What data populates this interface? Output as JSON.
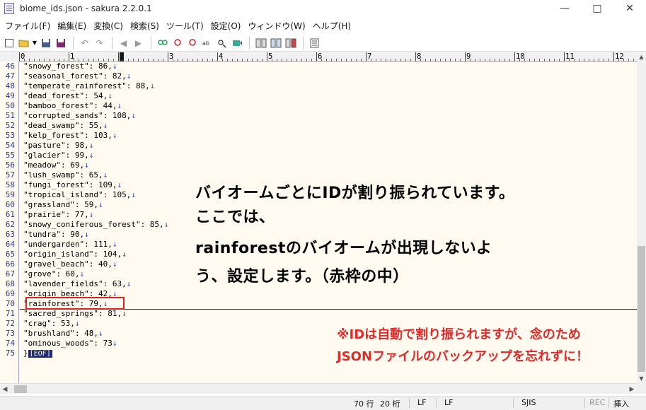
{
  "window": {
    "title": "biome_ids.json - sakura 2.2.0.1",
    "buttons": {
      "minimize": "—",
      "maximize": "□",
      "close": "✕"
    }
  },
  "menu": [
    "ファイル(F)",
    "編集(E)",
    "変換(C)",
    "検索(S)",
    "ツール(T)",
    "設定(O)",
    "ウィンドウ(W)",
    "ヘルプ(H)"
  ],
  "toolbar_icons": [
    "new-file-icon",
    "open-file-icon",
    "dropdown-icon",
    "save-icon",
    "save-all-icon",
    "undo-icon",
    "redo-icon",
    "jump-back-icon",
    "jump-forward-icon",
    "search-icon",
    "search-next-icon",
    "search-prev-icon",
    "replace-icon",
    "grep-icon",
    "tag-jump-icon",
    "compare-icon",
    "outline-icon",
    "function-list-icon",
    "settings-icon"
  ],
  "ruler": {
    "labels": [
      "0",
      "1",
      "2",
      "3",
      "4",
      "5",
      "6",
      "7",
      "8",
      "9",
      "10",
      "11",
      "12"
    ]
  },
  "editor": {
    "lines": [
      {
        "num": "46",
        "text": "\"snowy_forest\": 86,",
        "arrow": "↓"
      },
      {
        "num": "47",
        "text": "\"seasonal_forest\": 82,",
        "arrow": "↓"
      },
      {
        "num": "48",
        "text": "\"temperate_rainforest\": 88,",
        "arrow": "↓"
      },
      {
        "num": "49",
        "text": "\"dead_forest\": 54,",
        "arrow": "↓"
      },
      {
        "num": "50",
        "text": "\"bamboo_forest\": 44,",
        "arrow": "↓"
      },
      {
        "num": "51",
        "text": "\"corrupted_sands\": 108,",
        "arrow": "↓"
      },
      {
        "num": "52",
        "text": "\"dead_swamp\": 55,",
        "arrow": "↓"
      },
      {
        "num": "53",
        "text": "\"kelp_forest\": 103,",
        "arrow": "↓"
      },
      {
        "num": "54",
        "text": "\"pasture\": 98,",
        "arrow": "↓"
      },
      {
        "num": "55",
        "text": "\"glacier\": 99,",
        "arrow": "↓"
      },
      {
        "num": "56",
        "text": "\"meadow\": 69,",
        "arrow": "↓"
      },
      {
        "num": "57",
        "text": "\"lush_swamp\": 65,",
        "arrow": "↓"
      },
      {
        "num": "58",
        "text": "\"fungi_forest\": 109,",
        "arrow": "↓"
      },
      {
        "num": "59",
        "text": "\"tropical_island\": 105,",
        "arrow": "↓"
      },
      {
        "num": "60",
        "text": "\"grassland\": 59,",
        "arrow": "↓"
      },
      {
        "num": "61",
        "text": "\"prairie\": 77,",
        "arrow": "↓"
      },
      {
        "num": "62",
        "text": "\"snowy_coniferous_forest\": 85,",
        "arrow": "↓"
      },
      {
        "num": "63",
        "text": "\"tundra\": 90,",
        "arrow": "↓"
      },
      {
        "num": "64",
        "text": "\"undergarden\": 111,",
        "arrow": "↓"
      },
      {
        "num": "65",
        "text": "\"origin_island\": 104,",
        "arrow": "↓"
      },
      {
        "num": "66",
        "text": "\"gravel_beach\": 40,",
        "arrow": "↓"
      },
      {
        "num": "67",
        "text": "\"grove\": 60,",
        "arrow": "↓"
      },
      {
        "num": "68",
        "text": "\"lavender_fields\": 63,",
        "arrow": "↓"
      },
      {
        "num": "69",
        "text": "\"origin_beach\": 42,",
        "arrow": "↓"
      },
      {
        "num": "70",
        "text": "\"rainforest\": 79,",
        "arrow": "↓"
      },
      {
        "num": "71",
        "text": "\"sacred_springs\": 81,",
        "arrow": "↓"
      },
      {
        "num": "72",
        "text": "\"crag\": 53,",
        "arrow": "↓"
      },
      {
        "num": "73",
        "text": "\"brushland\": 48,",
        "arrow": "↓"
      },
      {
        "num": "74",
        "text": "\"ominous_woods\": 73",
        "arrow": "↓"
      },
      {
        "num": "75",
        "text": "}",
        "arrow": "",
        "eof": "[EOF]"
      }
    ],
    "highlighted_line": "70"
  },
  "annotation": {
    "main": [
      "バイオームごとにIDが割り振られています。",
      "ここでは、",
      "rainforestのバイオームが出現しないよ",
      "う、設定します。（赤枠の中）"
    ],
    "warning": [
      "※IDは自動で割り振られますが、念のため",
      "JSONファイルのバックアップを忘れずに！"
    ],
    "colors": {
      "warning": "#e02a2a",
      "highlight_box": "#e02020"
    }
  },
  "status": {
    "line": "70 行",
    "col": "20 桁",
    "eol1": "LF",
    "eol2": "LF",
    "encoding": "SJIS",
    "rec": "REC",
    "mode": "挿入"
  },
  "colors": {
    "editor_bg": "#fffbf0",
    "line_number": "#2c3a8a",
    "cursor_line": "#1a237e"
  }
}
